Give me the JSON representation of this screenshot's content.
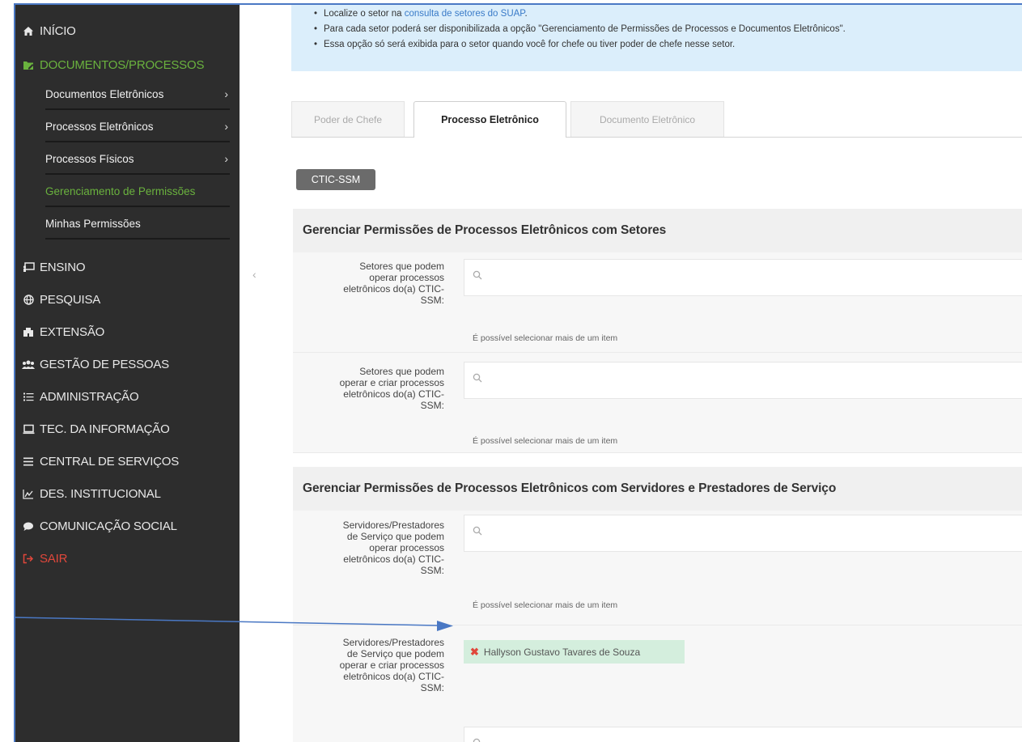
{
  "sidebar": {
    "nav": {
      "inicio": "INÍCIO",
      "documentos_processos": "DOCUMENTOS/PROCESSOS",
      "ensino": "ENSINO",
      "pesquisa": "PESQUISA",
      "extensao": "EXTENSÃO",
      "gestao_pessoas": "GESTÃO DE PESSOAS",
      "administracao": "ADMINISTRAÇÃO",
      "tec_informacao": "TEC. DA INFORMAÇÃO",
      "central_servicos": "CENTRAL DE SERVIÇOS",
      "des_institucional": "DES. INSTITUCIONAL",
      "comunicacao_social": "COMUNICAÇÃO SOCIAL",
      "sair": "SAIR"
    },
    "sub": {
      "documentos_eletronicos": "Documentos Eletrônicos",
      "processos_eletronicos": "Processos Eletrônicos",
      "processos_fisicos": "Processos Físicos",
      "gerenciamento_permissoes": "Gerenciamento de Permissões",
      "minhas_permissoes": "Minhas Permissões"
    },
    "accent_color": "#6ab23e",
    "logout_color": "#e0473b",
    "collapse_glyph": "‹"
  },
  "info": {
    "line1_prefix": "Localize o setor na ",
    "line1_link": "consulta de setores do SUAP",
    "line1_suffix": ".",
    "line2": "Para cada setor poderá ser disponibilizada a opção \"Gerenciamento de Permissões de Processos e Documentos Eletrônicos\".",
    "line3": "Essa opção só será exibida para o setor quando você for chefe ou tiver poder de chefe nesse setor."
  },
  "tabs": {
    "poder_de_chefe": "Poder de Chefe",
    "processo_eletronico": "Processo Eletrônico",
    "documento_eletronico": "Documento Eletrônico",
    "active": "processo_eletronico"
  },
  "sector_badge": "CTIC-SSM",
  "section_setores": {
    "title": "Gerenciar Permissões de Processos Eletrônicos com Setores",
    "field1_label": [
      "Setores que podem",
      "operar processos",
      "eletrônicos do(a) CTIC-",
      "SSM:"
    ],
    "field1_help": "É possível selecionar mais de um item",
    "field2_label": [
      "Setores que podem",
      "operar e criar processos",
      "eletrônicos do(a) CTIC-",
      "SSM:"
    ],
    "field2_help": "É possível selecionar mais de um item"
  },
  "section_servidores": {
    "title": "Gerenciar Permissões de Processos Eletrônicos com Servidores e Prestadores de Serviço",
    "field1_label": [
      "Servidores/Prestadores",
      "de Serviço que podem",
      "operar processos",
      "eletrônicos do(a) CTIC-",
      "SSM:"
    ],
    "field1_help": "É possível selecionar mais de um item",
    "field2_label": [
      "Servidores/Prestadores",
      "de Serviço que podem",
      "operar e criar processos",
      "eletrônicos do(a) CTIC-",
      "SSM:"
    ],
    "field2_selected": "Hallyson Gustavo Tavares de Souza"
  },
  "icons": {
    "search": "search-icon",
    "remove": "remove-icon",
    "chevron": "chevron-right-icon"
  }
}
